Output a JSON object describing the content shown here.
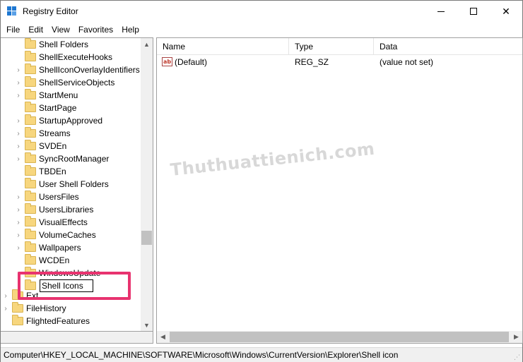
{
  "window": {
    "title": "Registry Editor",
    "controls": {
      "minimize": "minimize",
      "maximize": "maximize",
      "close": "✕"
    }
  },
  "menu": [
    "File",
    "Edit",
    "View",
    "Favorites",
    "Help"
  ],
  "tree": {
    "items": [
      {
        "label": "Shell Folders",
        "expandable": false
      },
      {
        "label": "ShellExecuteHooks",
        "expandable": false
      },
      {
        "label": "ShellIconOverlayIdentifiers",
        "expandable": true
      },
      {
        "label": "ShellServiceObjects",
        "expandable": true
      },
      {
        "label": "StartMenu",
        "expandable": true
      },
      {
        "label": "StartPage",
        "expandable": false
      },
      {
        "label": "StartupApproved",
        "expandable": true
      },
      {
        "label": "Streams",
        "expandable": true
      },
      {
        "label": "SVDEn",
        "expandable": true
      },
      {
        "label": "SyncRootManager",
        "expandable": true
      },
      {
        "label": "TBDEn",
        "expandable": false
      },
      {
        "label": "User Shell Folders",
        "expandable": false
      },
      {
        "label": "UsersFiles",
        "expandable": true
      },
      {
        "label": "UsersLibraries",
        "expandable": true
      },
      {
        "label": "VisualEffects",
        "expandable": true
      },
      {
        "label": "VolumeCaches",
        "expandable": true
      },
      {
        "label": "Wallpapers",
        "expandable": true
      },
      {
        "label": "WCDEn",
        "expandable": false
      },
      {
        "label": "WindowsUpdate",
        "expandable": true
      }
    ],
    "rename_value": "Shell Icons",
    "lower_items": [
      {
        "label": "Ext",
        "expandable": true
      },
      {
        "label": "FileHistory",
        "expandable": true
      },
      {
        "label": "FlightedFeatures",
        "expandable": false
      }
    ]
  },
  "list": {
    "columns": [
      "Name",
      "Type",
      "Data"
    ],
    "rows": [
      {
        "icon": "string-value-icon",
        "icon_text": "ab",
        "name": "(Default)",
        "type": "REG_SZ",
        "data": "(value not set)"
      }
    ]
  },
  "watermark": "Thuthuattienich.com",
  "status": {
    "path": "Computer\\HKEY_LOCAL_MACHINE\\SOFTWARE\\Microsoft\\Windows\\CurrentVersion\\Explorer\\Shell icon"
  },
  "colors": {
    "highlight": "#e8336f",
    "folder": "#f7d67e",
    "app_icon": "#1e78d2"
  }
}
